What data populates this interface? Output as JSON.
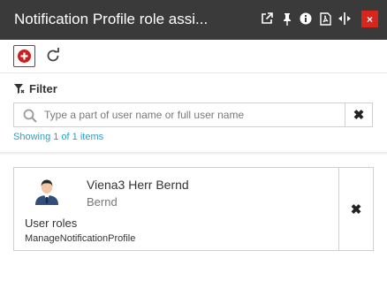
{
  "window": {
    "title": "Notification Profile role assi...",
    "icons": [
      "external-link-icon",
      "pin-icon",
      "info-icon",
      "pdf-icon",
      "resize-width-icon"
    ],
    "close_label": "×",
    "close_color": "#d9261c"
  },
  "toolbar": {
    "add_icon": "plus-circle-icon",
    "refresh_icon": "refresh-icon",
    "accent": "#cc1d1d"
  },
  "filter": {
    "label": "Filter",
    "placeholder": "Type a part of user name or full user name",
    "value": "",
    "clear_label": "✖",
    "showing": "Showing 1 of 1 items",
    "showing_color": "#2b9fc9"
  },
  "users": [
    {
      "name": "Viena3 Herr Bernd",
      "subname": "Bernd",
      "roles_title": "User roles",
      "roles": "ManageNotificationProfile",
      "remove_label": "✖"
    }
  ]
}
